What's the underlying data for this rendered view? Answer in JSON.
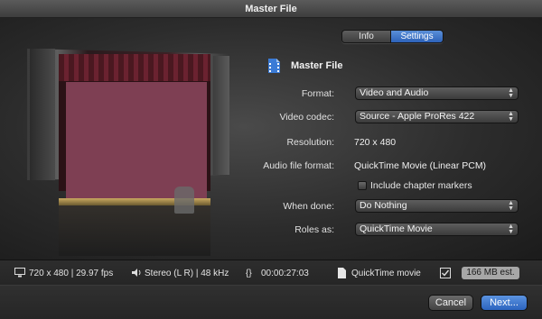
{
  "window": {
    "title": "Master File"
  },
  "tabs": {
    "info": "Info",
    "settings": "Settings",
    "selected": "Settings"
  },
  "section": {
    "title": "Master File",
    "icon": "film-file-icon"
  },
  "settings": {
    "format": {
      "label": "Format:",
      "value": "Video and Audio"
    },
    "video_codec": {
      "label": "Video codec:",
      "value": "Source - Apple ProRes 422"
    },
    "resolution": {
      "label": "Resolution:",
      "value": "720 x 480"
    },
    "audio_file_format": {
      "label": "Audio file format:",
      "value": "QuickTime Movie (Linear PCM)"
    },
    "chapter_markers": {
      "label": "Include chapter markers",
      "checked": false
    },
    "when_done": {
      "label": "When done:",
      "value": "Do Nothing"
    },
    "roles_as": {
      "label": "Roles as:",
      "value": "QuickTime Movie"
    }
  },
  "status": {
    "video": "720 x 480 | 29.97 fps",
    "audio": "Stereo (L R) | 48 kHz",
    "duration": "00:00:27:03",
    "container": "QuickTime movie",
    "size": "166 MB est."
  },
  "buttons": {
    "cancel": "Cancel",
    "next": "Next..."
  },
  "colors": {
    "accent": "#2d62b8",
    "preview_fill": "#7e3f53"
  }
}
